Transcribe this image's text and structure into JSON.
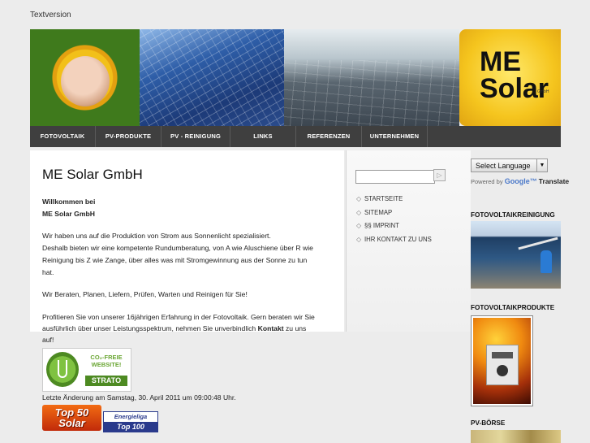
{
  "top": {
    "textversion": "Textversion"
  },
  "logo": {
    "line1": "ME",
    "line2": "Solar",
    "suffix": "GmbH"
  },
  "nav": [
    {
      "label": "FOTOVOLTAIK"
    },
    {
      "label": "PV-PRODUKTE"
    },
    {
      "label": "PV - REINIGUNG"
    },
    {
      "label": "LINKS"
    },
    {
      "label": "REFERENZEN"
    },
    {
      "label": "UNTERNEHMEN"
    }
  ],
  "main": {
    "title": "ME Solar GmbH",
    "welcome1": "Willkommen bei",
    "welcome2": "ME Solar GmbH",
    "p1a": "Wir haben uns auf die Produktion von Strom aus Sonnenlicht spezialisiert.",
    "p1b": "Deshalb bieten wir eine kompetente Rundumberatung, von A wie Aluschiene über R wie",
    "p1c": "Reinigung bis Z wie Zange, über alles was mit Stromgewinnung aus der Sonne zu tun",
    "p1d": "hat.",
    "p2": "Wir Beraten, Planen, Liefern, Prüfen, Warten und Reinigen für Sie!",
    "p3a": "Profitieren Sie von unserer 16jährigen Erfahrung in der Fotovoltaik. Gern beraten wir Sie",
    "p3b_pre": "ausführlich über unser Leistungsspektrum, nehmen Sie unverbindlich ",
    "p3b_link": "Kontakt",
    "p3b_post": " zu uns",
    "p3c": "auf!",
    "last_change": "Letzte Änderung am Samstag, 30. April 2011 um 09:00:48 Uhr."
  },
  "badges": {
    "strato_line1": "CO₂-FREIE",
    "strato_line2": "WEBSITE!",
    "strato_line3": "STRATO",
    "top50_line1": "Top 50",
    "top50_line2": "Solar",
    "energie_line1": "Energieliga",
    "energie_line2": "Top 100"
  },
  "sidebar": {
    "search_placeholder": "",
    "links": [
      {
        "label": "STARTSEITE"
      },
      {
        "label": "SITEMAP"
      },
      {
        "label": "§§ IMPRINT"
      },
      {
        "label": "IHR KONTAKT ZU UNS"
      }
    ]
  },
  "right": {
    "lang_select": "Select Language",
    "powered_by": "Powered by",
    "google": "Google™",
    "translate": "Translate",
    "head1": "FOTOVOLTAIKREINIGUNG",
    "head2": "FOTOVOLTAIKPRODUKTE",
    "head3": "PV-BÖRSE"
  }
}
